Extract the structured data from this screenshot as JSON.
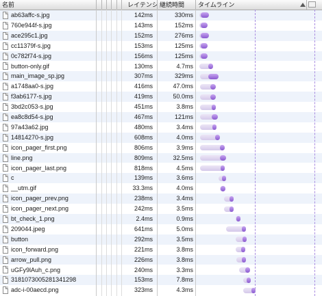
{
  "header": {
    "name": "名前",
    "latency": "レイテンシ",
    "duration": "継続時間",
    "timeline": "タイムライン"
  },
  "colors": {
    "bar_solid": "#9b6be0",
    "bar_light": "#dcd2ef",
    "row_alt": "#eef3fb"
  },
  "icons": [
    "file-icon",
    "sort-ascending-icon",
    "column-toggle-icon"
  ],
  "rows": [
    {
      "name": "ab63affc-s.jpg",
      "latency": "142ms",
      "duration": "330ms"
    },
    {
      "name": "760e944f-s.jpg",
      "latency": "143ms",
      "duration": "152ms"
    },
    {
      "name": "ace295c1.jpg",
      "latency": "152ms",
      "duration": "276ms"
    },
    {
      "name": "cc11379f-s.jpg",
      "latency": "153ms",
      "duration": "125ms"
    },
    {
      "name": "0c782f74-s.jpg",
      "latency": "156ms",
      "duration": "125ms"
    },
    {
      "name": "button-only.gif",
      "latency": "130ms",
      "duration": "4.7ms"
    },
    {
      "name": "main_image_sp.jpg",
      "latency": "307ms",
      "duration": "329ms"
    },
    {
      "name": "a1748aa0-s.jpg",
      "latency": "416ms",
      "duration": "47.0ms"
    },
    {
      "name": "f3ab6177-s.jpg",
      "latency": "419ms",
      "duration": "50.0ms"
    },
    {
      "name": "3bd2c053-s.jpg",
      "latency": "451ms",
      "duration": "3.8ms"
    },
    {
      "name": "ea8c8d54-s.jpg",
      "latency": "467ms",
      "duration": "121ms"
    },
    {
      "name": "97a43a62.jpg",
      "latency": "480ms",
      "duration": "3.4ms"
    },
    {
      "name": "14814270-s.jpg",
      "latency": "608ms",
      "duration": "4.0ms"
    },
    {
      "name": "icon_pager_first.png",
      "latency": "806ms",
      "duration": "3.9ms"
    },
    {
      "name": "line.png",
      "latency": "809ms",
      "duration": "32.5ms"
    },
    {
      "name": "icon_pager_last.png",
      "latency": "818ms",
      "duration": "4.5ms"
    },
    {
      "name": "c",
      "latency": "139ms",
      "duration": "3.6ms"
    },
    {
      "name": "__utm.gif",
      "latency": "33.3ms",
      "duration": "4.0ms"
    },
    {
      "name": "icon_pager_prev.png",
      "latency": "238ms",
      "duration": "3.4ms"
    },
    {
      "name": "icon_pager_next.png",
      "latency": "242ms",
      "duration": "3.5ms"
    },
    {
      "name": "bt_check_1.png",
      "latency": "2.4ms",
      "duration": "0.9ms"
    },
    {
      "name": "209044.jpeg",
      "latency": "641ms",
      "duration": "5.0ms"
    },
    {
      "name": "button",
      "latency": "292ms",
      "duration": "3.5ms"
    },
    {
      "name": "icon_forward.png",
      "latency": "221ms",
      "duration": "3.8ms"
    },
    {
      "name": "arrow_pull.png",
      "latency": "226ms",
      "duration": "3.8ms"
    },
    {
      "name": "uGFy9lAuh_c.png",
      "latency": "240ms",
      "duration": "3.3ms"
    },
    {
      "name": "3181073005281341298",
      "latency": "153ms",
      "duration": "7.8ms"
    },
    {
      "name": "adc-i-00aecd.png",
      "latency": "323ms",
      "duration": "4.3ms"
    }
  ],
  "timeline_bars": [
    {
      "start": 0.005,
      "light": 0.01,
      "solid": 0.07
    },
    {
      "start": 0.005,
      "light": 0.01,
      "solid": 0.06
    },
    {
      "start": 0.005,
      "light": 0.01,
      "solid": 0.068
    },
    {
      "start": 0.005,
      "light": 0.01,
      "solid": 0.058
    },
    {
      "start": 0.005,
      "light": 0.01,
      "solid": 0.058
    },
    {
      "start": 0.005,
      "light": 0.075,
      "solid": 0.035
    },
    {
      "start": 0.01,
      "light": 0.07,
      "solid": 0.08
    },
    {
      "start": 0.01,
      "light": 0.085,
      "solid": 0.045
    },
    {
      "start": 0.01,
      "light": 0.085,
      "solid": 0.045
    },
    {
      "start": 0.01,
      "light": 0.095,
      "solid": 0.035
    },
    {
      "start": 0.01,
      "light": 0.095,
      "solid": 0.05
    },
    {
      "start": 0.01,
      "light": 0.1,
      "solid": 0.035
    },
    {
      "start": 0.01,
      "light": 0.125,
      "solid": 0.035
    },
    {
      "start": 0.01,
      "light": 0.16,
      "solid": 0.04
    },
    {
      "start": 0.01,
      "light": 0.16,
      "solid": 0.05
    },
    {
      "start": 0.01,
      "light": 0.165,
      "solid": 0.035
    },
    {
      "start": 0.16,
      "light": 0.03,
      "solid": 0.035
    },
    {
      "start": 0.17,
      "light": 0.01,
      "solid": 0.035
    },
    {
      "start": 0.205,
      "light": 0.045,
      "solid": 0.035
    },
    {
      "start": 0.205,
      "light": 0.045,
      "solid": 0.035
    },
    {
      "start": 0.3,
      "light": 0.005,
      "solid": 0.035
    },
    {
      "start": 0.22,
      "light": 0.13,
      "solid": 0.035
    },
    {
      "start": 0.3,
      "light": 0.055,
      "solid": 0.035
    },
    {
      "start": 0.3,
      "light": 0.045,
      "solid": 0.035
    },
    {
      "start": 0.305,
      "light": 0.045,
      "solid": 0.035
    },
    {
      "start": 0.33,
      "light": 0.045,
      "solid": 0.04
    },
    {
      "start": 0.36,
      "light": 0.03,
      "solid": 0.035
    },
    {
      "start": 0.36,
      "light": 0.065,
      "solid": 0.035
    }
  ]
}
